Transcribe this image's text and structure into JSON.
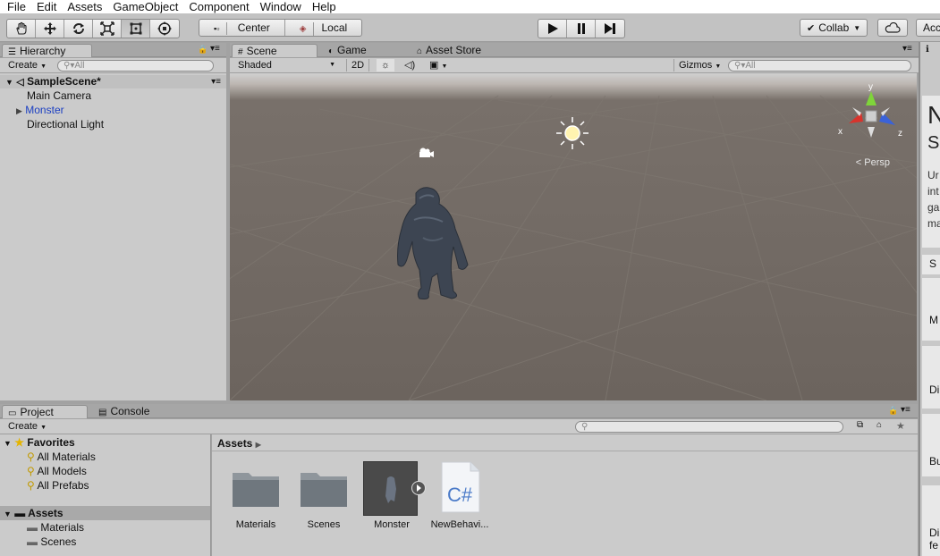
{
  "menu": [
    "File",
    "Edit",
    "Assets",
    "GameObject",
    "Component",
    "Window",
    "Help"
  ],
  "toolbar": {
    "tools": [
      "hand-tool",
      "move-tool",
      "rotate-tool",
      "scale-tool",
      "rect-tool",
      "transform-tool"
    ],
    "center": "Center",
    "local": "Local",
    "collab": "Collab",
    "account": "Acc"
  },
  "hierarchy": {
    "tab": "Hierarchy",
    "create": "Create",
    "search_placeholder": "All",
    "scene": "SampleScene*",
    "items": [
      "Main Camera",
      "Monster",
      "Directional Light"
    ]
  },
  "scene_tabs": {
    "scene": "Scene",
    "game": "Game",
    "asset_store": "Asset Store"
  },
  "scene_bar": {
    "shading": "Shaded",
    "mode_2d": "2D",
    "gizmos": "Gizmos",
    "search_placeholder": "All"
  },
  "gizmo": {
    "y": "y",
    "x": "x",
    "z": "z",
    "persp": "Persp"
  },
  "project": {
    "tab_project": "Project",
    "tab_console": "Console",
    "create": "Create",
    "breadcrumb": "Assets",
    "favorites": "Favorites",
    "favorite_items": [
      "All Materials",
      "All Models",
      "All Prefabs"
    ],
    "assets_root": "Assets",
    "asset_folders": [
      "Materials",
      "Scenes"
    ],
    "assets": [
      "Materials",
      "Scenes",
      "Monster",
      "NewBehavi..."
    ]
  },
  "inspector": {
    "letters": [
      "N",
      "S",
      "Ur",
      "int",
      "ga",
      "ma",
      "S",
      "M",
      "Di",
      "Bu",
      "Di",
      "fe"
    ]
  },
  "colors": {
    "selected_text": "#1a3ec2",
    "script_icon": "#4a7ac8"
  }
}
